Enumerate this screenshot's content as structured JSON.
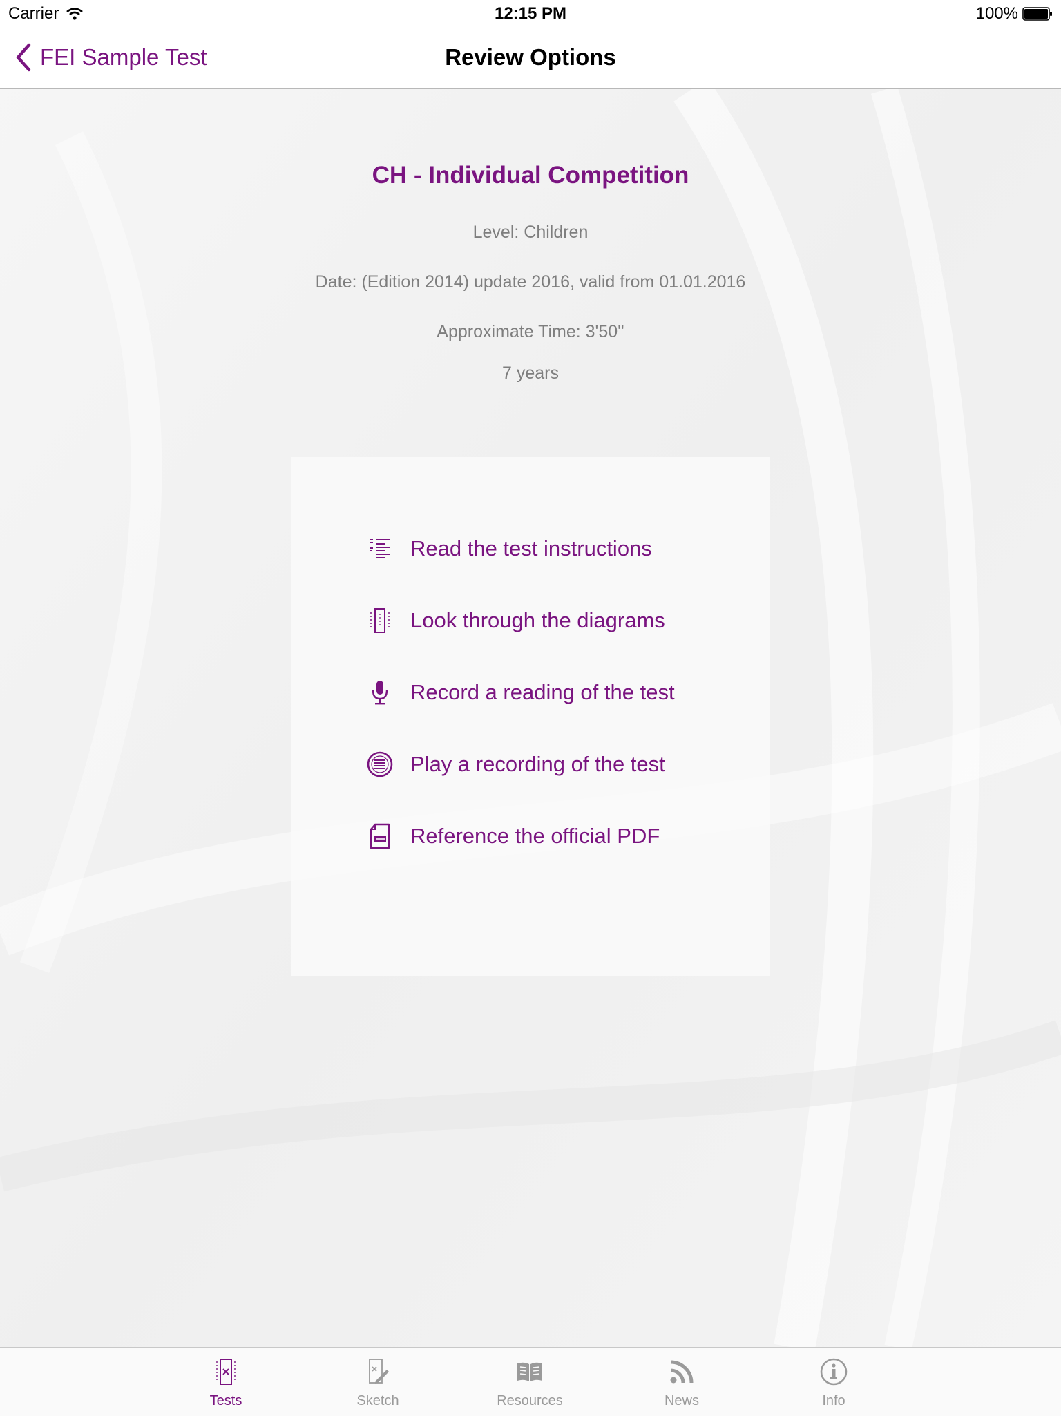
{
  "status_bar": {
    "carrier": "Carrier",
    "time": "12:15 PM",
    "battery": "100%"
  },
  "nav": {
    "back_label": "FEI Sample Test",
    "title": "Review Options"
  },
  "test": {
    "title": "CH - Individual Competition",
    "level": "Level:  Children",
    "date": "Date:  (Edition 2014) update 2016, valid from 01.01.2016",
    "time": "Approximate Time:  3'50''",
    "age": "7 years"
  },
  "options": [
    {
      "label": "Read the test instructions",
      "icon": "list-icon"
    },
    {
      "label": "Look through the diagrams",
      "icon": "diagram-icon"
    },
    {
      "label": "Record a reading of the test",
      "icon": "microphone-icon"
    },
    {
      "label": "Play a recording of the test",
      "icon": "play-list-icon"
    },
    {
      "label": "Reference the official PDF",
      "icon": "pdf-icon"
    }
  ],
  "tabs": [
    {
      "label": "Tests",
      "icon": "tests-icon",
      "active": true
    },
    {
      "label": "Sketch",
      "icon": "sketch-icon",
      "active": false
    },
    {
      "label": "Resources",
      "icon": "book-icon",
      "active": false
    },
    {
      "label": "News",
      "icon": "rss-icon",
      "active": false
    },
    {
      "label": "Info",
      "icon": "info-icon",
      "active": false
    }
  ],
  "colors": {
    "accent": "#7a1480",
    "muted_text": "#7e7e7e",
    "inactive_tab": "#9a9a9a"
  }
}
